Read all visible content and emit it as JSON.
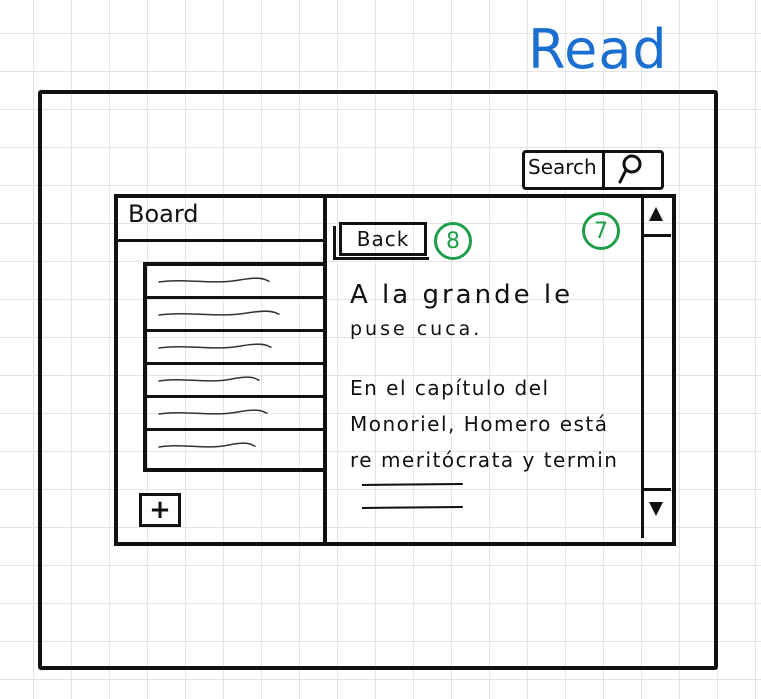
{
  "title": "Read",
  "search": {
    "label": "Search"
  },
  "board": {
    "title": "Board",
    "add_label": "+"
  },
  "reader": {
    "back_label": "Back",
    "badge_back": "8",
    "badge_corner": "7",
    "lines": [
      "A la grande le",
      "puse cuca.",
      "En el capítulo del",
      "Monoriel, Homero está",
      "re meritócrata y termin"
    ]
  },
  "colors": {
    "title": "#1a6fd1",
    "badges": "#1f9e4a",
    "ink": "#111111"
  },
  "icons": {
    "search": "magnifier-icon",
    "scroll_up": "triangle-up-icon",
    "scroll_down": "triangle-down-icon"
  }
}
